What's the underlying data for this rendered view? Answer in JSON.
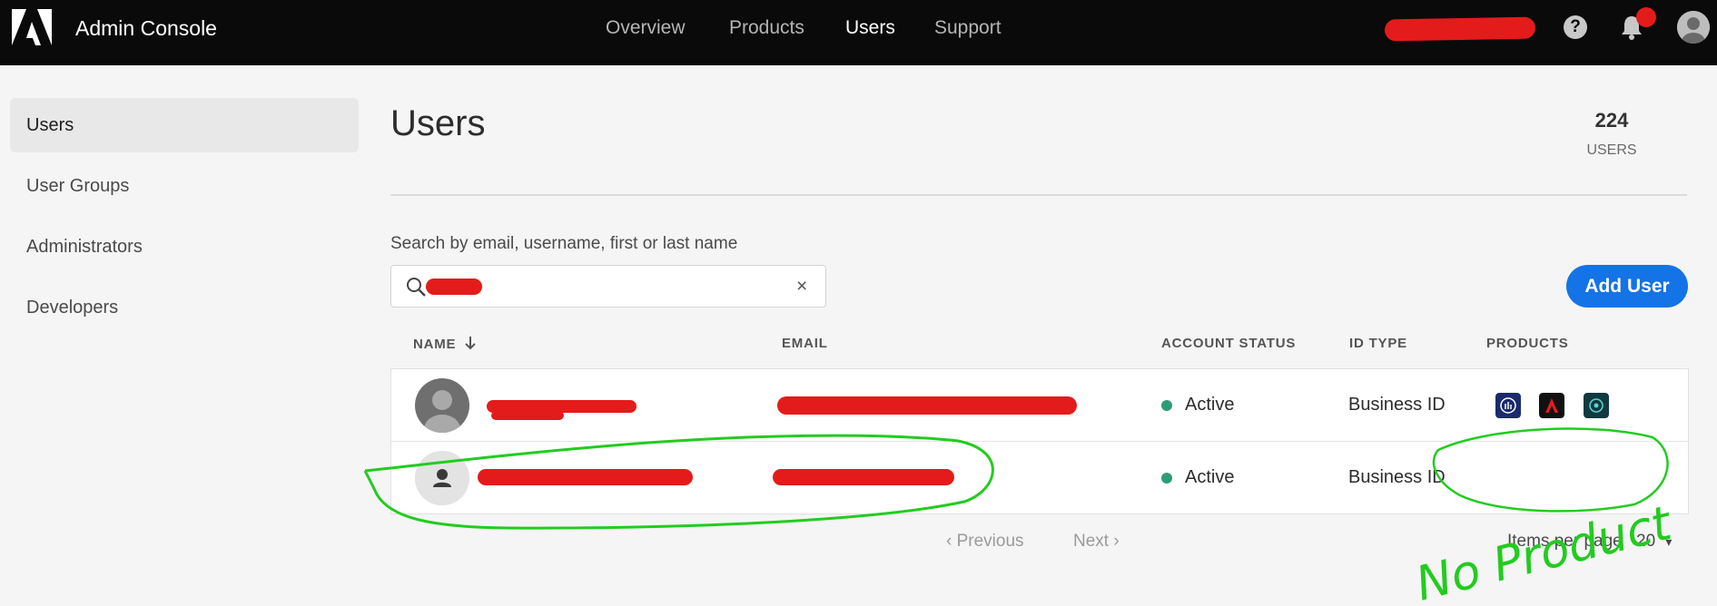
{
  "header": {
    "app_title": "Admin Console",
    "nav": [
      "Overview",
      "Products",
      "Users",
      "Support"
    ],
    "active_nav": "Users",
    "help_glyph": "?"
  },
  "sidebar": {
    "items": [
      {
        "label": "Users",
        "active": true
      },
      {
        "label": "User Groups",
        "active": false
      },
      {
        "label": "Administrators",
        "active": false
      },
      {
        "label": "Developers",
        "active": false
      }
    ]
  },
  "main": {
    "title": "Users",
    "user_count": "224",
    "user_count_label": "USERS",
    "search_label": "Search by email, username, first or last name",
    "search_clear": "×",
    "add_user_label": "Add User",
    "columns": {
      "name": "NAME",
      "email": "EMAIL",
      "status": "ACCOUNT STATUS",
      "id_type": "ID TYPE",
      "products": "PRODUCTS"
    },
    "rows": [
      {
        "status": "Active",
        "id_type": "Business ID",
        "products": [
          "analytics-product-icon",
          "adobe-product-icon",
          "experience-product-icon"
        ]
      },
      {
        "status": "Active",
        "id_type": "Business ID",
        "products": []
      }
    ],
    "pager": {
      "previous": "Previous",
      "next": "Next"
    },
    "items_per_page_label": "Items per page",
    "items_per_page_value": "20"
  },
  "annotation": {
    "text": "No Product",
    "color": "#22cc1f"
  },
  "colors": {
    "redaction": "#e41b1b",
    "accent": "#1473e6",
    "active_status": "#2d9d78"
  }
}
